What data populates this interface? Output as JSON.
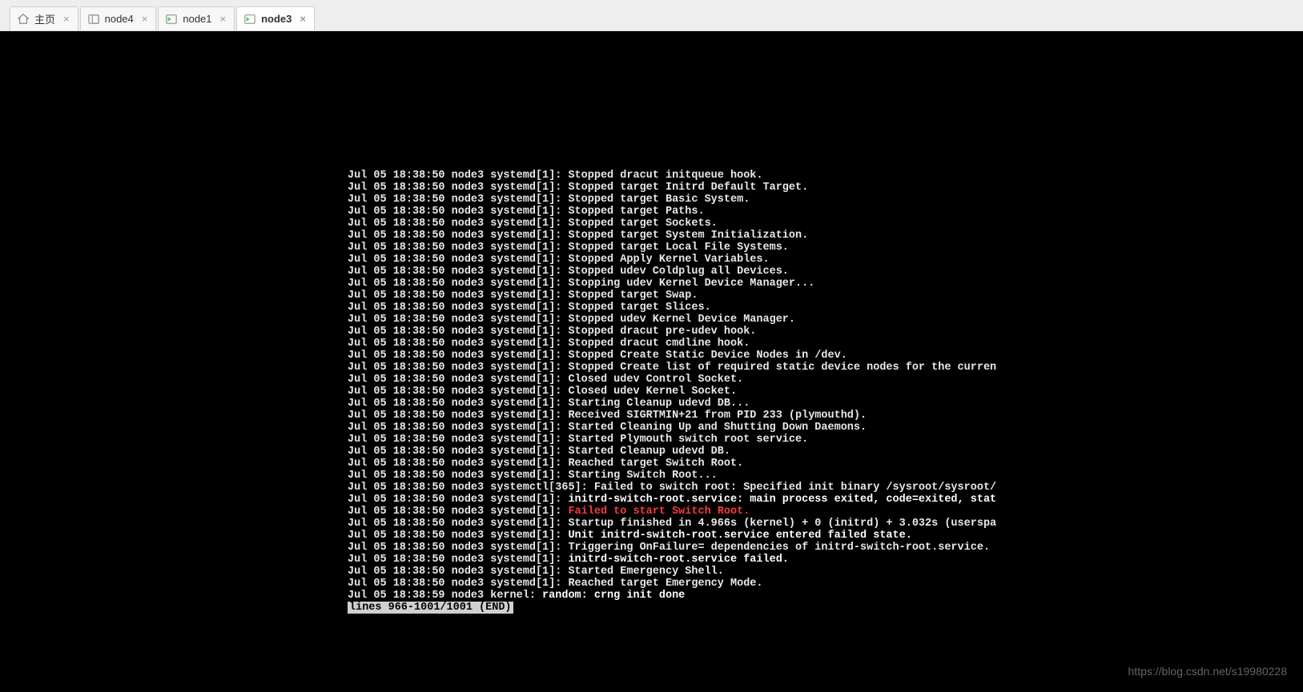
{
  "tabs": [
    {
      "label": "主页",
      "icon": "home",
      "closable": true,
      "active": false
    },
    {
      "label": "node4",
      "icon": "terminal",
      "closable": true,
      "active": false
    },
    {
      "label": "node1",
      "icon": "terminal-green",
      "closable": true,
      "active": false
    },
    {
      "label": "node3",
      "icon": "terminal-green",
      "closable": true,
      "active": true
    }
  ],
  "log_prefix": "Jul 05 18:38:50 node3 ",
  "log_lines": [
    {
      "src": "systemd[1]: ",
      "msg": "Stopped dracut initqueue hook."
    },
    {
      "src": "systemd[1]: ",
      "msg": "Stopped target Initrd Default Target."
    },
    {
      "src": "systemd[1]: ",
      "msg": "Stopped target Basic System."
    },
    {
      "src": "systemd[1]: ",
      "msg": "Stopped target Paths."
    },
    {
      "src": "systemd[1]: ",
      "msg": "Stopped target Sockets."
    },
    {
      "src": "systemd[1]: ",
      "msg": "Stopped target System Initialization."
    },
    {
      "src": "systemd[1]: ",
      "msg": "Stopped target Local File Systems."
    },
    {
      "src": "systemd[1]: ",
      "msg": "Stopped Apply Kernel Variables."
    },
    {
      "src": "systemd[1]: ",
      "msg": "Stopped udev Coldplug all Devices."
    },
    {
      "src": "systemd[1]: ",
      "msg": "Stopping udev Kernel Device Manager..."
    },
    {
      "src": "systemd[1]: ",
      "msg": "Stopped target Swap."
    },
    {
      "src": "systemd[1]: ",
      "msg": "Stopped target Slices."
    },
    {
      "src": "systemd[1]: ",
      "msg": "Stopped udev Kernel Device Manager."
    },
    {
      "src": "systemd[1]: ",
      "msg": "Stopped dracut pre-udev hook."
    },
    {
      "src": "systemd[1]: ",
      "msg": "Stopped dracut cmdline hook."
    },
    {
      "src": "systemd[1]: ",
      "msg": "Stopped Create Static Device Nodes in /dev."
    },
    {
      "src": "systemd[1]: ",
      "msg": "Stopped Create list of required static device nodes for the curren"
    },
    {
      "src": "systemd[1]: ",
      "msg": "Closed udev Control Socket."
    },
    {
      "src": "systemd[1]: ",
      "msg": "Closed udev Kernel Socket."
    },
    {
      "src": "systemd[1]: ",
      "msg": "Starting Cleanup udevd DB..."
    },
    {
      "src": "systemd[1]: ",
      "msg": "Received SIGRTMIN+21 from PID 233 (plymouthd)."
    },
    {
      "src": "systemd[1]: ",
      "msg": "Started Cleaning Up and Shutting Down Daemons."
    },
    {
      "src": "systemd[1]: ",
      "msg": "Started Plymouth switch root service."
    },
    {
      "src": "systemd[1]: ",
      "msg": "Started Cleanup udevd DB."
    },
    {
      "src": "systemd[1]: ",
      "msg": "Reached target Switch Root."
    },
    {
      "src": "systemd[1]: ",
      "msg": "Starting Switch Root..."
    },
    {
      "src": "systemctl[365]: ",
      "msg": "Failed to switch root: Specified init binary /sysroot/sysroot/"
    },
    {
      "src": "systemd[1]: ",
      "msg": "initrd-switch-root.service: main process exited, code=exited, stat",
      "style": "bold"
    },
    {
      "src": "systemd[1]: ",
      "msg": "Failed to start Switch Root.",
      "style": "red"
    },
    {
      "src": "systemd[1]: ",
      "msg": "Startup finished in 4.966s (kernel) + 0 (initrd) + 3.032s (userspa"
    },
    {
      "src": "systemd[1]: ",
      "msg": "Unit initrd-switch-root.service entered failed state.",
      "style": "bold"
    },
    {
      "src": "systemd[1]: ",
      "msg": "Triggering OnFailure= dependencies of initrd-switch-root.service."
    },
    {
      "src": "systemd[1]: ",
      "msg": "initrd-switch-root.service failed.",
      "style": "bold"
    },
    {
      "src": "systemd[1]: ",
      "msg": "Started Emergency Shell."
    },
    {
      "src": "systemd[1]: ",
      "msg": "Reached target Emergency Mode."
    }
  ],
  "final_line": {
    "prefix": "Jul 05 18:38:59 node3 kernel: ",
    "msg": "random: crng init done"
  },
  "pager_status": "lines 966-1001/1001 (END)",
  "watermark": "https://blog.csdn.net/s19980228"
}
